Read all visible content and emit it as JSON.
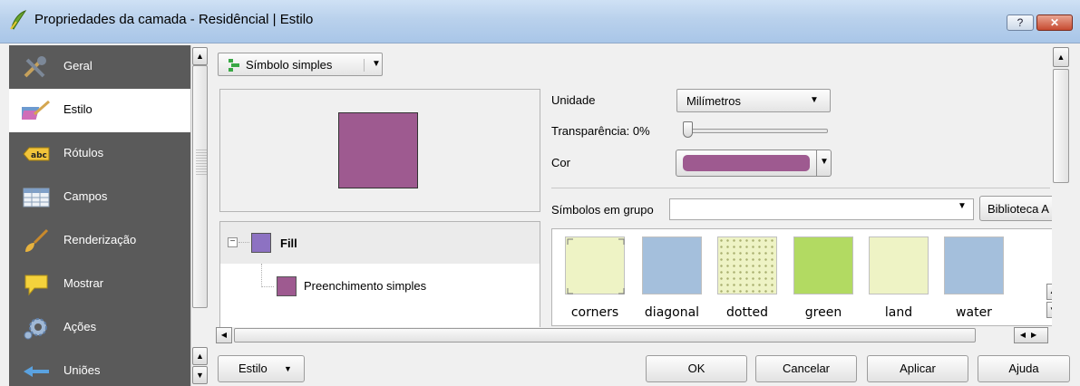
{
  "window": {
    "title": "Propriedades da camada - Residêncial | Estilo",
    "help_button": "?",
    "close_button": "✕"
  },
  "sidebar": {
    "items": [
      {
        "label": "Geral",
        "icon": "tools-icon"
      },
      {
        "label": "Estilo",
        "icon": "paint-brush-icon",
        "active": true
      },
      {
        "label": "Rótulos",
        "icon": "abc-label-icon"
      },
      {
        "label": "Campos",
        "icon": "table-icon"
      },
      {
        "label": "Renderização",
        "icon": "brush-icon"
      },
      {
        "label": "Mostrar",
        "icon": "speech-bubble-icon"
      },
      {
        "label": "Ações",
        "icon": "gear-icon"
      },
      {
        "label": "Uniões",
        "icon": "join-icon"
      }
    ]
  },
  "renderer": {
    "selected": "Símbolo simples"
  },
  "layer_tree": {
    "fill_label": "Fill",
    "fill_color": "#8d72c2",
    "simple_fill_label": "Preenchimento simples",
    "simple_fill_color": "#9e5a90"
  },
  "properties": {
    "unit_label": "Unidade",
    "unit_value": "Milímetros",
    "transparency_label": "Transparência: 0%",
    "transparency_value": 0,
    "color_label": "Cor",
    "color_value": "#9e5a90",
    "group_label": "Símbolos em grupo",
    "group_value": "",
    "library_button": "Biblioteca A"
  },
  "symbols": [
    {
      "name": "corners",
      "color": "#eef3c5"
    },
    {
      "name": "diagonal",
      "color": "#a4bfdc"
    },
    {
      "name": "dotted",
      "color": "#eef3c5"
    },
    {
      "name": "green",
      "color": "#b2da62"
    },
    {
      "name": "land",
      "color": "#eef3c5"
    },
    {
      "name": "water",
      "color": "#a4bfdc"
    }
  ],
  "buttons": {
    "style": "Estilo",
    "ok": "OK",
    "cancel": "Cancelar",
    "apply": "Aplicar",
    "help": "Ajuda"
  }
}
